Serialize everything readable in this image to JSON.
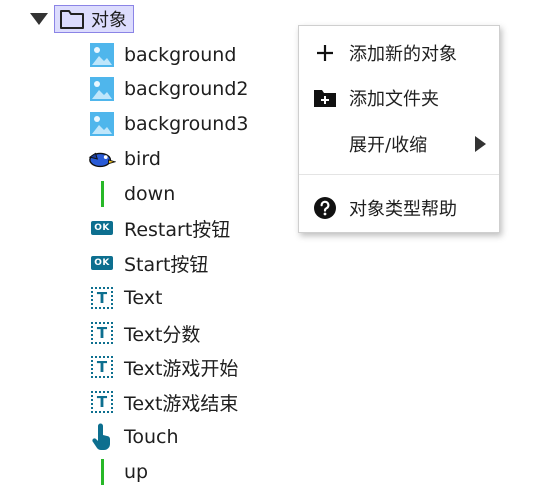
{
  "tree": {
    "root": {
      "label": "对象"
    },
    "items": [
      {
        "label": "background",
        "icon": "image-icon"
      },
      {
        "label": "background2",
        "icon": "image-icon"
      },
      {
        "label": "background3",
        "icon": "image-icon"
      },
      {
        "label": "bird",
        "icon": "bird-icon"
      },
      {
        "label": "down",
        "icon": "bar-icon"
      },
      {
        "label": "Restart按钮",
        "icon": "ok-button-icon",
        "badge": "OK"
      },
      {
        "label": "Start按钮",
        "icon": "ok-button-icon",
        "badge": "OK"
      },
      {
        "label": "Text",
        "icon": "text-object-icon",
        "glyph": "T"
      },
      {
        "label": "Text分数",
        "icon": "text-object-icon",
        "glyph": "T"
      },
      {
        "label": "Text游戏开始",
        "icon": "text-object-icon",
        "glyph": "T"
      },
      {
        "label": "Text游戏结束",
        "icon": "text-object-icon",
        "glyph": "T"
      },
      {
        "label": "Touch",
        "icon": "touch-hand-icon"
      },
      {
        "label": "up",
        "icon": "bar-icon"
      }
    ]
  },
  "context_menu": {
    "add_object": "添加新的对象",
    "add_folder": "添加文件夹",
    "expand_collapse": "展开/收缩",
    "help": "对象类型帮助"
  },
  "colors": {
    "selection_bg": "#dcdcfd",
    "selection_border": "#8b84e6",
    "accent_teal": "#0d6f8f",
    "bar_green": "#28b828"
  }
}
